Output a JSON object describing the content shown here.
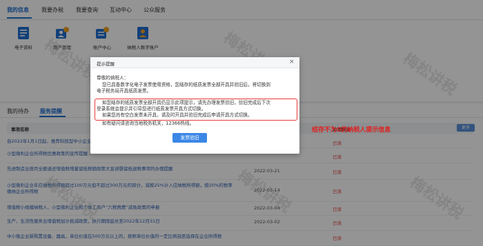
{
  "top_tabs": [
    {
      "label": "我的信息"
    },
    {
      "label": "我要办税"
    },
    {
      "label": "我要查询"
    },
    {
      "label": "互动中心"
    },
    {
      "label": "公众服务"
    }
  ],
  "apps": [
    {
      "label": "电子资料"
    },
    {
      "label": "用户管理"
    },
    {
      "label": "账户中心"
    },
    {
      "label": "纳税人数字账户"
    }
  ],
  "lower_tabs": [
    {
      "label": "我的待办"
    },
    {
      "label": "服务提醒"
    }
  ],
  "table": {
    "col_title": "事项名称",
    "col_status": "处理状态",
    "more_label": "更多",
    "rows": [
      {
        "title": "自2022年1月1日起，推荐科技型中小企业...",
        "date": "",
        "status": "已读"
      },
      {
        "title": "小型微利企业所得税优惠政策的宣传提醒...",
        "date": "",
        "status": "已读"
      },
      {
        "title": "先进制造业按月全额退还增值税增量留抵税额政策大宣讲暨留抵退税事项的办理提醒",
        "date": "2022-03-21",
        "status": "已读"
      },
      {
        "title": "小型微利企业年应纳税所得额超过100万元但不超过300万元的部分，减按25%计入应纳税所得额，按20%的税率缴纳企业所得税",
        "date": "2022-03-14",
        "status": "已读"
      },
      {
        "title": "增值税小规模纳税人、小型微利企业和个体工商户“六税两费”减免政策的申报",
        "date": "2022-03-04",
        "status": "已读"
      },
      {
        "title": "生产、生活性服务业增值税加计抵减政策，执行期限延长至2022年12月31日",
        "date": "2022-03-02",
        "status": "已读"
      },
      {
        "title": "中小微企业新购置设备、器具，单位价值在500万元以上的，按照单位价值的一定比例自愿选择在企业所得税",
        "date": "",
        "status": "已读"
      }
    ]
  },
  "dialog": {
    "title": "提示提醒",
    "close": "×",
    "greeting": "尊敬的纳税人：",
    "line1": "您已具备数字化电子发票使用资格，您结存的纸质发票全部开具并验旧后，将切换到",
    "line2": "电子税务局开具纸质发票。",
    "hl1": "如您结存的纸质发票全部开具仍显示此项提示，请先办理发票验旧，验旧完成后下次",
    "hl2": "登录系统会提示并引导您进行纸质发票开具方式切换。",
    "hl3": "如果您尚有空白发票未开具，请及时开具并验旧完成后申请开具方式切换。",
    "line6": "如有疑问请咨询当地税务机关，12366热线。",
    "button": "发票验旧"
  },
  "annotation": "结存不为0的纳税人提示信息",
  "watermark": "梅松讲税",
  "colors": {
    "accent": "#1f6fd0",
    "highlight": "#e53935",
    "button": "#3b86e6"
  }
}
